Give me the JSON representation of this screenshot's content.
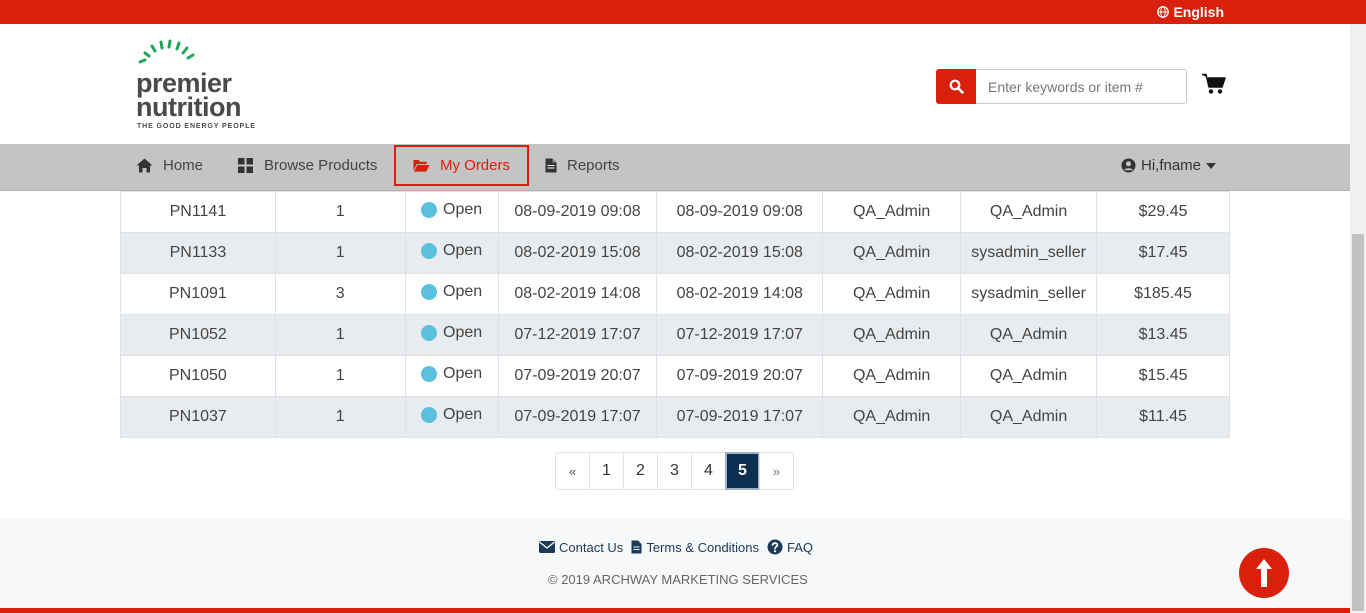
{
  "colors": {
    "brand_red": "#d9200c",
    "nav_gray": "#c4c4c4",
    "active_page": "#0d2f52",
    "status_open": "#5bc0de",
    "logo_green": "#22a55a"
  },
  "topbar": {
    "language": "English",
    "icon": "globe-icon"
  },
  "header": {
    "logo": {
      "line1": "premier",
      "line2": "nutrition",
      "tagline": "THE GOOD ENERGY PEOPLE"
    },
    "search": {
      "placeholder": "Enter keywords or item #",
      "value": "",
      "icon": "search-icon"
    },
    "cart_icon": "shopping-cart-icon"
  },
  "nav": {
    "items": [
      {
        "label": "Home",
        "icon": "home-icon"
      },
      {
        "label": "Browse Products",
        "icon": "grid-icon"
      },
      {
        "label": "My Orders",
        "icon": "folder-open-icon",
        "active": true
      },
      {
        "label": "Reports",
        "icon": "document-icon"
      }
    ],
    "user": {
      "label": "Hi,fname",
      "icon": "user-circle-icon"
    }
  },
  "orders": {
    "rows": [
      {
        "id": "PN1141",
        "qty": "1",
        "status": "Open",
        "date1": "08-09-2019 09:08",
        "date2": "08-09-2019 09:08",
        "user1": "QA_Admin",
        "user2": "QA_Admin",
        "total": "$29.45"
      },
      {
        "id": "PN1133",
        "qty": "1",
        "status": "Open",
        "date1": "08-02-2019 15:08",
        "date2": "08-02-2019 15:08",
        "user1": "QA_Admin",
        "user2": "sysadmin_seller",
        "total": "$17.45"
      },
      {
        "id": "PN1091",
        "qty": "3",
        "status": "Open",
        "date1": "08-02-2019 14:08",
        "date2": "08-02-2019 14:08",
        "user1": "QA_Admin",
        "user2": "sysadmin_seller",
        "total": "$185.45"
      },
      {
        "id": "PN1052",
        "qty": "1",
        "status": "Open",
        "date1": "07-12-2019 17:07",
        "date2": "07-12-2019 17:07",
        "user1": "QA_Admin",
        "user2": "QA_Admin",
        "total": "$13.45"
      },
      {
        "id": "PN1050",
        "qty": "1",
        "status": "Open",
        "date1": "07-09-2019 20:07",
        "date2": "07-09-2019 20:07",
        "user1": "QA_Admin",
        "user2": "QA_Admin",
        "total": "$15.45"
      },
      {
        "id": "PN1037",
        "qty": "1",
        "status": "Open",
        "date1": "07-09-2019 17:07",
        "date2": "07-09-2019 17:07",
        "user1": "QA_Admin",
        "user2": "QA_Admin",
        "total": "$11.45"
      }
    ]
  },
  "pagination": {
    "prev": "«",
    "pages": [
      "1",
      "2",
      "3",
      "4",
      "5"
    ],
    "current": "5",
    "next": "»"
  },
  "footer": {
    "links": [
      {
        "label": "Contact Us",
        "icon": "envelope-icon"
      },
      {
        "label": "Terms & Conditions",
        "icon": "document-icon"
      },
      {
        "label": "FAQ",
        "icon": "question-circle-icon"
      }
    ],
    "copyright": "© 2019 ARCHWAY MARKETING SERVICES"
  },
  "scroll_to_top_icon": "arrow-up-icon"
}
